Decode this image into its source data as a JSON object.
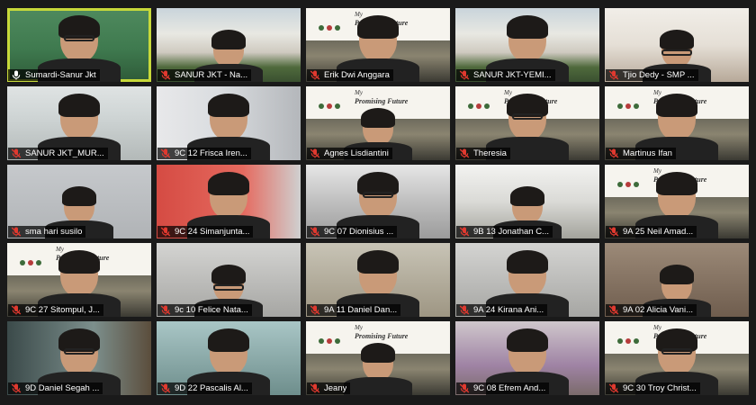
{
  "tiles": [
    {
      "name": "Sumardi-Sanur Jkt",
      "mic": "mic-on-icon",
      "bg": "bg-green",
      "active": true
    },
    {
      "name": "SANUR JKT - Na...",
      "mic": "mic-muted-icon",
      "bg": "bg-building"
    },
    {
      "name": "Erik Dwi Anggara",
      "mic": "mic-muted-icon",
      "bg": "bg-slide",
      "slide": true
    },
    {
      "name": "SANUR JKT-YEMI...",
      "mic": "mic-muted-icon",
      "bg": "bg-building"
    },
    {
      "name": "Tjio Dedy - SMP ...",
      "mic": "mic-muted-icon",
      "bg": "bg-office"
    },
    {
      "name": "SANUR JKT_MUR...",
      "mic": "mic-muted-icon",
      "bg": "bg-room1"
    },
    {
      "name": "9C 12 Frisca Iren...",
      "mic": "mic-muted-icon",
      "bg": "bg-wallart"
    },
    {
      "name": "Agnes Lisdiantini",
      "mic": "mic-muted-icon",
      "bg": "bg-slide",
      "slide": true
    },
    {
      "name": "Theresia",
      "mic": "mic-muted-icon",
      "bg": "bg-slide",
      "slide": true
    },
    {
      "name": "Martinus Ifan",
      "mic": "mic-muted-icon",
      "bg": "bg-slide",
      "slide": true
    },
    {
      "name": "sma hari susilo",
      "mic": "mic-muted-icon",
      "bg": "bg-room2"
    },
    {
      "name": "9C 24 Simanjunta...",
      "mic": "mic-muted-icon",
      "bg": "bg-red"
    },
    {
      "name": "9C 07 Dionisius ...",
      "mic": "mic-muted-icon",
      "bg": "bg-dark"
    },
    {
      "name": "9B 13 Jonathan C...",
      "mic": "mic-muted-icon",
      "bg": "bg-desk"
    },
    {
      "name": "9A 25 Neil Amad...",
      "mic": "mic-muted-icon",
      "bg": "bg-slide",
      "slide": true
    },
    {
      "name": "9C 27 Sitompul, J...",
      "mic": "mic-muted-icon",
      "bg": "bg-slide",
      "slide": true
    },
    {
      "name": "9c 10 Felice Nata...",
      "mic": "mic-muted-icon",
      "bg": "bg-grey"
    },
    {
      "name": "9A 11 Daniel Dan...",
      "mic": "mic-muted-icon",
      "bg": "bg-beige"
    },
    {
      "name": "9A 24 Kirana Ani...",
      "mic": "mic-muted-icon",
      "bg": "bg-grey"
    },
    {
      "name": "9A 02 Alicia Vani...",
      "mic": "mic-muted-icon",
      "bg": "bg-warm"
    },
    {
      "name": "9D Daniel Segah ...",
      "mic": "mic-muted-icon",
      "bg": "bg-window"
    },
    {
      "name": "9D 22 Pascalis Al...",
      "mic": "mic-muted-icon",
      "bg": "bg-teal"
    },
    {
      "name": "Jeany",
      "mic": "mic-muted-icon",
      "bg": "bg-slide",
      "slide": true
    },
    {
      "name": "9C 08 Efrem And...",
      "mic": "mic-muted-icon",
      "bg": "bg-purple"
    },
    {
      "name": "9C 30 Troy Christ...",
      "mic": "mic-muted-icon",
      "bg": "bg-slide",
      "slide": true
    }
  ],
  "slide": {
    "line1": "My",
    "line2": "Promising Future"
  },
  "colors": {
    "active_border": "#c7d93a",
    "muted_mic": "#e0392f",
    "label_bg": "rgba(0,0,0,0.72)"
  }
}
